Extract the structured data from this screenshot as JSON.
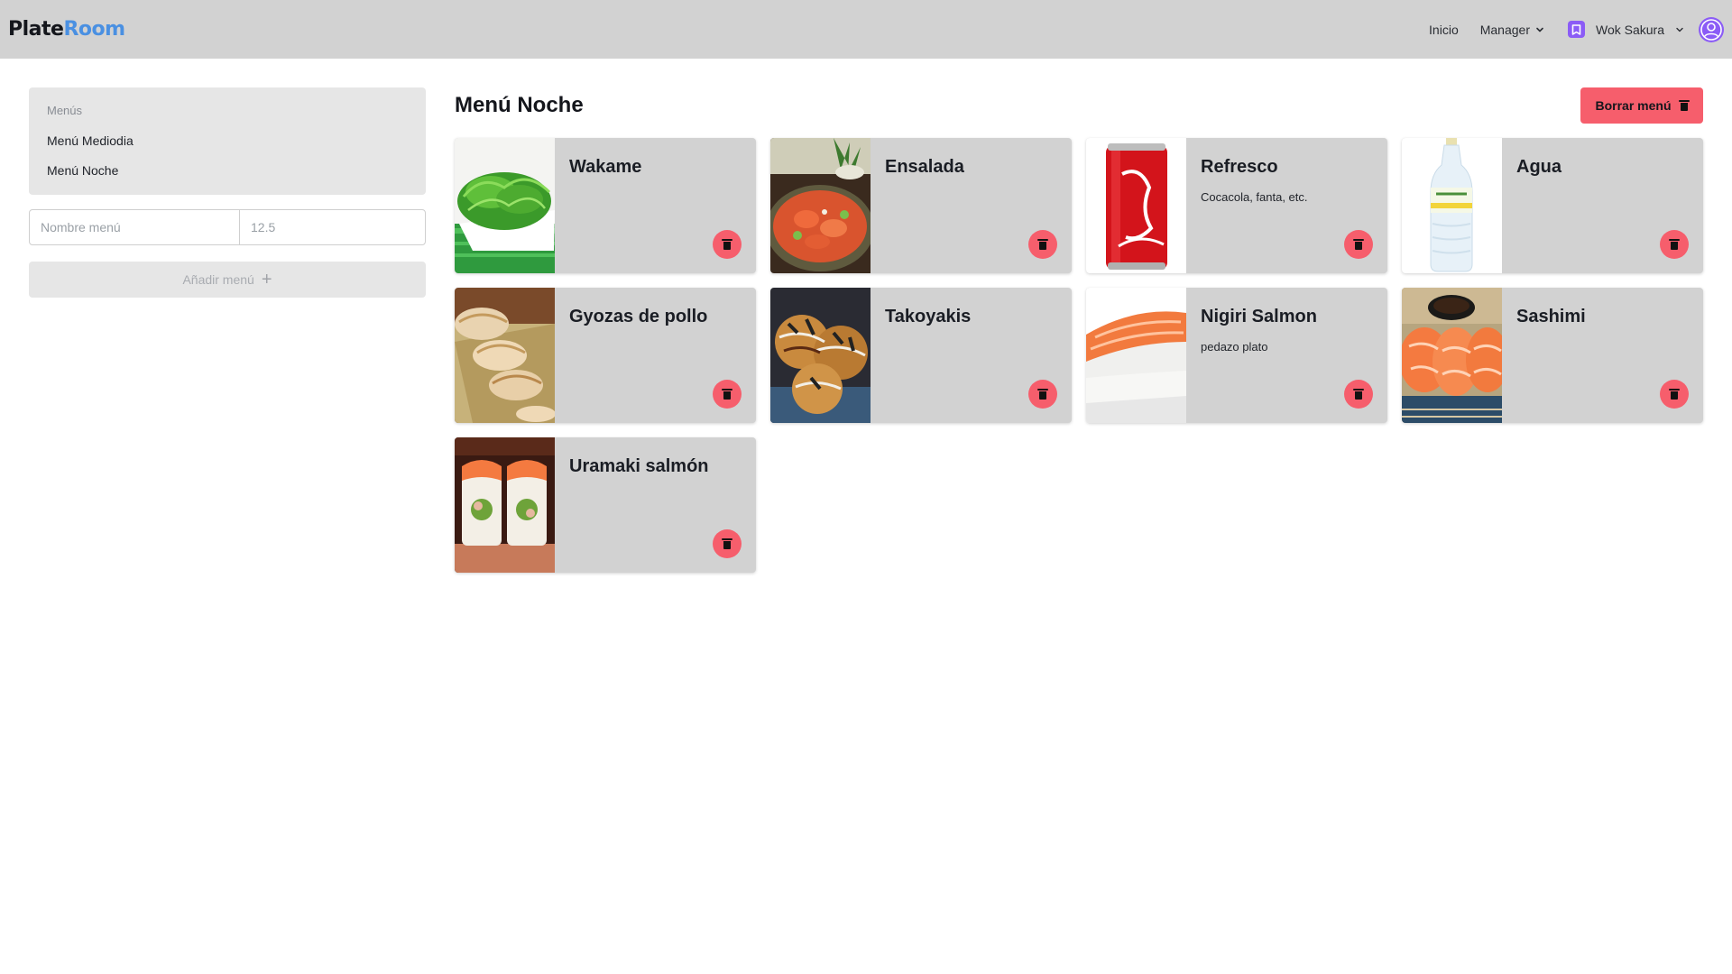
{
  "brand": {
    "part1": "Plate",
    "part2": "Room"
  },
  "nav": {
    "home": "Inicio",
    "manager": "Manager",
    "restaurant": "Wok Sakura"
  },
  "sidebar": {
    "title": "Menús",
    "items": [
      "Menú Mediodia",
      "Menú Noche"
    ],
    "name_placeholder": "Nombre menú",
    "price_placeholder": "12.5",
    "add_label": "Añadir menú",
    "add_icon": "plus-icon"
  },
  "main": {
    "title": "Menú Noche",
    "delete_label": "Borrar menú",
    "delete_icon": "trash-icon"
  },
  "dishes": [
    {
      "name": "Wakame",
      "desc": "",
      "image": "wakame-seaweed-photo"
    },
    {
      "name": "Ensalada",
      "desc": "",
      "image": "salmon-salad-bowl-photo"
    },
    {
      "name": "Refresco",
      "desc": "Cocacola, fanta, etc.",
      "image": "coca-cola-can-photo"
    },
    {
      "name": "Agua",
      "desc": "",
      "image": "water-bottle-photo"
    },
    {
      "name": "Gyozas de pollo",
      "desc": "",
      "image": "gyoza-dumplings-photo"
    },
    {
      "name": "Takoyakis",
      "desc": "",
      "image": "takoyaki-photo"
    },
    {
      "name": "Nigiri Salmon",
      "desc": "pedazo plato",
      "image": "salmon-nigiri-photo"
    },
    {
      "name": "Sashimi",
      "desc": "",
      "image": "salmon-sashimi-photo"
    },
    {
      "name": "Uramaki salmón",
      "desc": "",
      "image": "salmon-uramaki-photo"
    }
  ],
  "colors": {
    "navbar": "#d2d2d2",
    "brand_accent": "#4a90e2",
    "danger": "#f65e6c",
    "card": "#d2d2d2",
    "panel": "#e6e6e6",
    "avatar": "#8b5cf6"
  }
}
